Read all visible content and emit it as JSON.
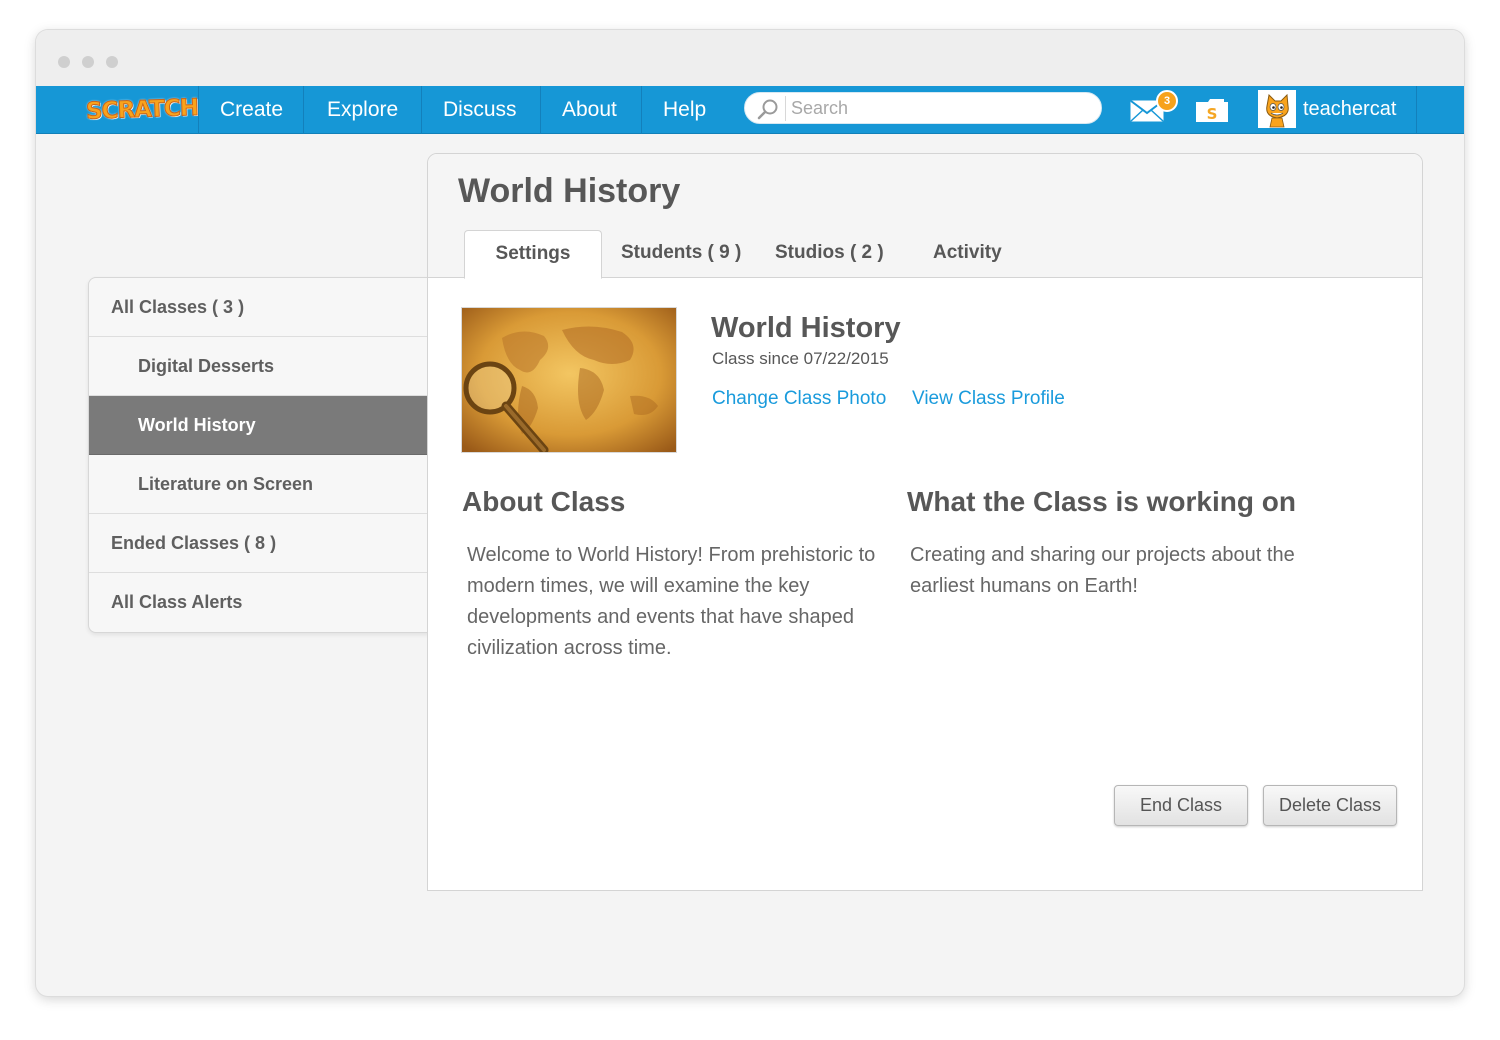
{
  "navbar": {
    "logo_text": "SCRATCH",
    "items": [
      "Create",
      "Explore",
      "Discuss",
      "About",
      "Help"
    ],
    "search_placeholder": "Search",
    "messages_count": "3",
    "username": "teachercat",
    "bar_color": "#1697d6"
  },
  "sidebar": {
    "items": [
      {
        "label": "All Classes ( 3 )"
      },
      {
        "label": "Digital Desserts"
      },
      {
        "label": "World History"
      },
      {
        "label": "Literature on Screen"
      },
      {
        "label": "Ended Classes ( 8 )"
      },
      {
        "label": "All Class Alerts"
      }
    ],
    "active_color": "#7a7a7a"
  },
  "panel": {
    "title": "World History",
    "tabs": [
      "Settings",
      "Students ( 9 )",
      "Studios ( 2 )",
      "Activity"
    ],
    "class_name": "World History",
    "class_since": "Class since 07/22/2015",
    "change_photo_link": "Change Class Photo",
    "view_profile_link": "View Class Profile",
    "about_title": "About Class",
    "about_body": [
      "Welcome to World History! From prehistoric to",
      "modern times, we will examine the key",
      "developments and events that have shaped",
      "civilization across time."
    ],
    "working_title": "What the Class is working on",
    "working_body": [
      "Creating and sharing our projects about the",
      "earliest humans on Earth!"
    ],
    "end_button": "End Class",
    "delete_button": "Delete Class",
    "link_color": "#1a9bdc"
  },
  "icons": [
    "search-icon",
    "mail-icon",
    "folder-icon",
    "avatar-cat-icon",
    "class-photo-world-map"
  ]
}
